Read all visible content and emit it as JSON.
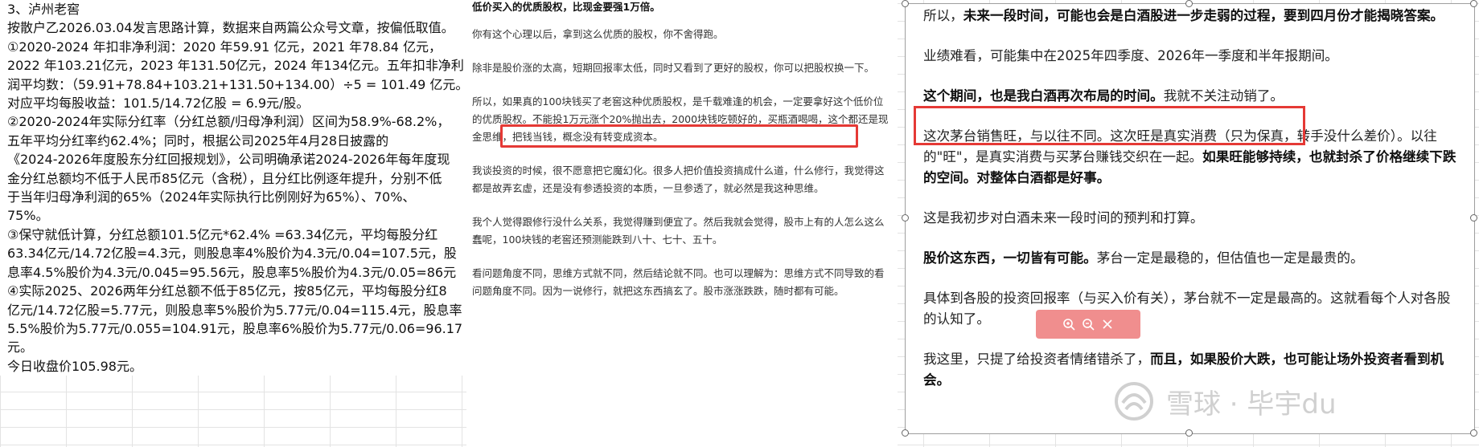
{
  "left_text": [
    "3、泸州老窖",
    "按散户乙2026.03.04发言思路计算，数据来自两篇公众号文章，按偏低取值。",
    "①2020-2024 年扣非净利润：2020 年59.91 亿元，2021 年78.84 亿元，",
    "2022 年103.21亿元，2023 年131.50亿元，2024 年134亿元。五年扣非净利",
    "润平均数：（59.91+78.84+103.21+131.50+134.00）÷5 = 101.49 亿元。",
    "对应平均每股收益：101.5/14.72亿股 = 6.9元/股。",
    "②2020-2024年实际分红率（分红总额/归母净利润）区间为58.9%-68.2%，",
    "五年平均分红率约62.4%；同时，根据公司2025年4月28日披露的",
    "《2024-2026年度股东分红回报规划》，公司明确承诺2024-2026年每年度现",
    "金分红总额均不低于人民币85亿元（含税），且分红比例逐年提升，分别不低",
    "于当年归母净利润的65%（2024年实际执行比例刚好为65%）、70%、",
    "75%。",
    "③保守就低计算，分红总额101.5亿元*62.4% =63.34亿元，平均每股分红",
    "63.34亿元/14.72亿股=4.3元，则股息率4%股价为4.3元/0.04=107.5元，股",
    "息率4.5%股价为4.3元/0.045=95.56元，股息率5%股价为4.3元/0.05=86元",
    "④实际2025、2026两年分红总额不低于85亿元，按85亿元，平均每股分红8",
    "亿元/14.72亿股=5.77元，则股息率5%股价为5.77元/0.04=115.4元，股息率",
    "5.5%股价为5.77元/0.055=104.91元，股息率6%股价为5.77元/0.06=96.17",
    "元。",
    "今日收盘价105.98元。"
  ],
  "middle": {
    "top_line": "低价买入的优质股权，比现金要强1万倍。",
    "p1": "你有这个心理以后，拿到这么优质的股权，你不舍得跑。",
    "p2": "除非是股价涨的太高，短期回报率太低，同时又看到了更好的股权，你可以把股权换一下。",
    "p3_pre": "所以，",
    "p3_highlight": "如果真的100块钱买了老窖这种优质股权，是千载难逢的机会，",
    "p3_post": "一定要拿好这个低价位的优质股权。不能投1万元涨个20%抛出去，2000块钱吃顿好的，买瓶酒喝喝，这个都还是现金思维，把钱当钱，概念没有转变成资本。",
    "p4": "我谈投资的时候，很不愿意把它魔幻化。很多人把价值投资搞成什么道，什么修行，我觉得这都是故弄玄虚，还是没有参透投资的本质，一旦参透了，就必然是我这种思维。",
    "p5": "我个人觉得跟修行没什么关系，我觉得赚到便宜了。然后我就会觉得，股市上有的人怎么这么蠢呢，100块钱的老窖还预测能跌到八十、七十、五十。",
    "p6": "看问题角度不同，思维方式就不同，然后结论就不同。也可以理解为：思维方式不同导致的看问题角度不同。因为一说修行，就把这东西搞玄了。股市涨涨跌跌，随时都有可能。"
  },
  "right": {
    "p1_pre": "所以，",
    "p1_bold": "未来一段时间，可能也会是白酒股进一步走弱的过程，要到四月份才能揭晓答案。",
    "p2": "业绩难看，可能集中在2025年四季度、2026年一季度和半年报期间。",
    "p3_bold": "这个期间，也是我白酒再次布局的时间。",
    "p3_post": "我就不关注动销了。",
    "p4_pre": "这次茅台销售旺，与以往不同。这次旺是真实消费（只为保真，转手没什么差价）。以往的\"旺\"，是真实消费与买茅台赚钱交织在一起。",
    "p4_bold": "如果旺能够持续，也就封杀了价格继续下跌的空间。对整体白酒都是好事。",
    "p5": "这是我初步对白酒未来一段时间的预判和打算。",
    "p6_bold": "股价这东西，一切皆有可能。",
    "p6_post": "茅台一定是最稳的，但估值也一定是最贵的。",
    "p7": "具体到各股的投资回报率（与买入价有关），茅台就不一定是最高的。这就看每个人对各股的认知了。",
    "p8_pre": "我这里，只提了给投资者情绪错杀了，",
    "p8_bold": "而且，如果股价大跌，也可能让场外投资者看到机会。"
  },
  "watermark": {
    "text": "雪球 · 毕宇du"
  },
  "icons": {
    "toolbar": [
      "zoom-in-icon",
      "zoom-out-icon",
      "close-icon"
    ],
    "watermark_logo": "snowball-logo"
  }
}
